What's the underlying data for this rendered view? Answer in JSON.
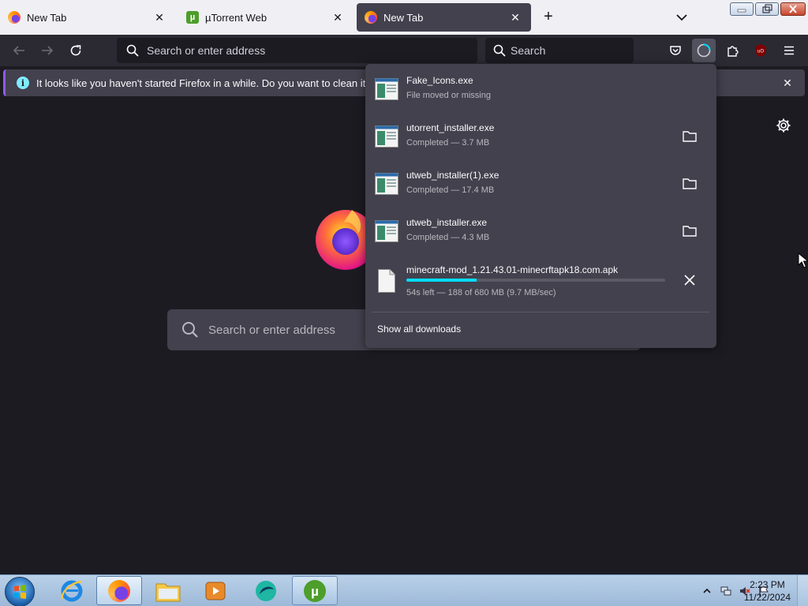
{
  "tabs": [
    {
      "title": "New Tab",
      "favicon": "firefox-icon",
      "active": false
    },
    {
      "title": "µTorrent Web",
      "favicon": "utorrent-icon",
      "active": false
    },
    {
      "title": "New Tab",
      "favicon": "firefox-icon",
      "active": true
    }
  ],
  "navbar": {
    "url_placeholder": "Search or enter address",
    "search_placeholder": "Search"
  },
  "notification": {
    "text": "It looks like you haven't started Firefox in a while. Do you want to clean it up for"
  },
  "hero": {
    "search_placeholder": "Search or enter address"
  },
  "downloads": {
    "items": [
      {
        "name": "Fake_Icons.exe",
        "status": "File moved or missing",
        "icon": "exe-file-icon"
      },
      {
        "name": "utorrent_installer.exe",
        "status": "Completed — 3.7 MB",
        "icon": "exe-file-icon"
      },
      {
        "name": "utweb_installer(1).exe",
        "status": "Completed — 17.4 MB",
        "icon": "exe-file-icon"
      },
      {
        "name": "utweb_installer.exe",
        "status": "Completed — 4.3 MB",
        "icon": "exe-file-icon"
      },
      {
        "name": "minecraft-mod_1.21.43.01-minecrftapk18.com.apk",
        "status": "54s left — 188 of 680 MB (9.7 MB/sec)",
        "icon": "generic-file-icon",
        "progress": 0.27
      }
    ],
    "show_all_label": "Show all downloads"
  },
  "taskbar": {
    "apps": [
      "internet-explorer-icon",
      "firefox-icon",
      "file-explorer-icon",
      "media-player-icon",
      "browser-app-icon",
      "utorrent-icon"
    ],
    "time": "2:23 PM",
    "date": "11/22/2024"
  },
  "colors": {
    "accent": "#00ddff",
    "panel": "#42414d",
    "background": "#1c1b22"
  }
}
